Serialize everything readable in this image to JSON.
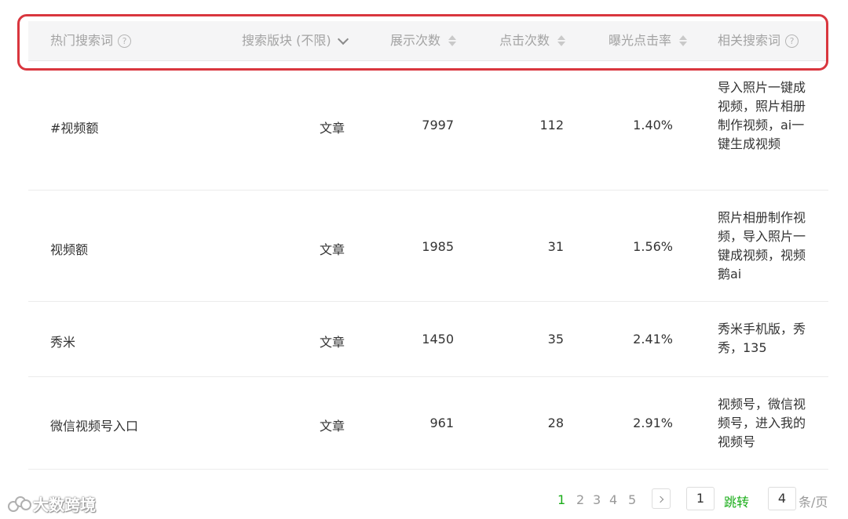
{
  "table": {
    "columns": [
      {
        "label": "热门搜索词",
        "icon": "help-icon"
      },
      {
        "label": "搜索版块 (不限)",
        "icon": "chevron-down-icon"
      },
      {
        "label": "展示次数",
        "icon": "sort-icon"
      },
      {
        "label": "点击次数",
        "icon": "sort-icon"
      },
      {
        "label": "曝光点击率",
        "icon": "sort-icon"
      },
      {
        "label": "相关搜索词",
        "icon": "help-icon"
      }
    ],
    "rows": [
      {
        "keyword": "#视频额",
        "section": "文章",
        "impressions": "7997",
        "clicks": "112",
        "ctr": "1.40%",
        "related": "导入照片一键成视频，照片相册制作视频，ai一键生成视频"
      },
      {
        "keyword": "视频额",
        "section": "文章",
        "impressions": "1985",
        "clicks": "31",
        "ctr": "1.56%",
        "related": "照片相册制作视频，导入照片一键成视频，视频鹅ai"
      },
      {
        "keyword": "秀米",
        "section": "文章",
        "impressions": "1450",
        "clicks": "35",
        "ctr": "2.41%",
        "related": "秀米手机版，秀秀，135"
      },
      {
        "keyword": "微信视频号入口",
        "section": "文章",
        "impressions": "961",
        "clicks": "28",
        "ctr": "2.91%",
        "related": "视频号，微信视频号，进入我的视频号"
      }
    ]
  },
  "pagination": {
    "pages": [
      "1",
      "2",
      "3",
      "4",
      "5"
    ],
    "current": "1",
    "goto_value": "1",
    "jump_label": "跳转",
    "page_size": "4",
    "page_size_suffix": "条/页"
  },
  "watermark": {
    "text": "大数跨境"
  },
  "colors": {
    "accent": "#1aad19",
    "highlight_border": "#d9363e",
    "header_bg": "#f5f5f6"
  }
}
